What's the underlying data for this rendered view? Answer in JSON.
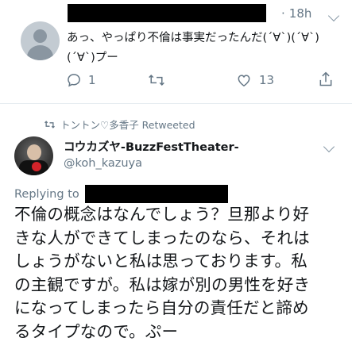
{
  "tweet1": {
    "time": "18h",
    "text": "あっ、やっぱり不倫は事実だったんだ(´∀`)(´∀`)(´∀`)プー",
    "actions": {
      "reply_count": "1",
      "retweet_count": "",
      "like_count": "13"
    }
  },
  "retweet_label": "トントン♡多香子 Retweeted",
  "tweet2": {
    "display_name": "コウカズヤ-BuzzFestTheater-",
    "handle": "@koh_kazuya",
    "replying_to_label": "Replying to",
    "text": "不倫の概念はなんでしょう？旦那より好\nきな人ができてしまったのなら、それは\nしょうがないと私は思っております。私\nの主観ですが。私は嫁が別の男性を好き\nになってしまったら自分の責任だと諦め\nるタイプなので。ぷー"
  },
  "colors": {
    "text_primary": "#14171a",
    "text_secondary": "#657786",
    "divider": "#e6ecf0",
    "icon_gray": "#657786"
  },
  "icons": [
    "default-avatar-icon",
    "chevron-down-icon",
    "reply-icon",
    "retweet-icon",
    "like-icon",
    "share-icon"
  ]
}
